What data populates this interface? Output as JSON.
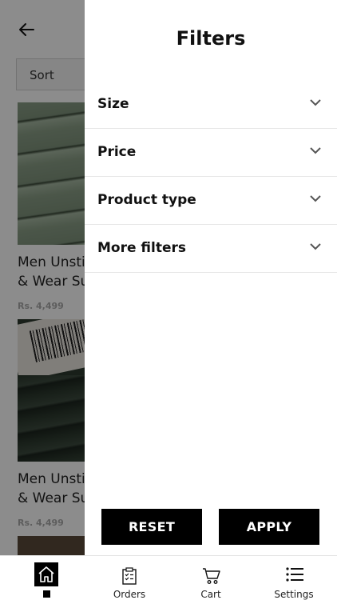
{
  "background_listing": {
    "sort_label": "Sort",
    "products": [
      {
        "title_line1": "Men Unstit",
        "title_line2": "& Wear Su",
        "price": "Rs. 4,499"
      },
      {
        "title_line1": "Men Unstit",
        "title_line2": "& Wear Su",
        "price": "Rs. 4,499"
      }
    ]
  },
  "drawer": {
    "title": "Filters",
    "filters": [
      {
        "label": "Size"
      },
      {
        "label": "Price"
      },
      {
        "label": "Product type"
      },
      {
        "label": "More filters"
      }
    ],
    "reset_label": "RESET",
    "apply_label": "APPLY"
  },
  "bottom_nav": {
    "items": [
      {
        "label": "",
        "icon": "home-icon",
        "active": true
      },
      {
        "label": "Orders",
        "icon": "orders-icon"
      },
      {
        "label": "Cart",
        "icon": "cart-icon"
      },
      {
        "label": "Settings",
        "icon": "settings-icon"
      }
    ]
  }
}
